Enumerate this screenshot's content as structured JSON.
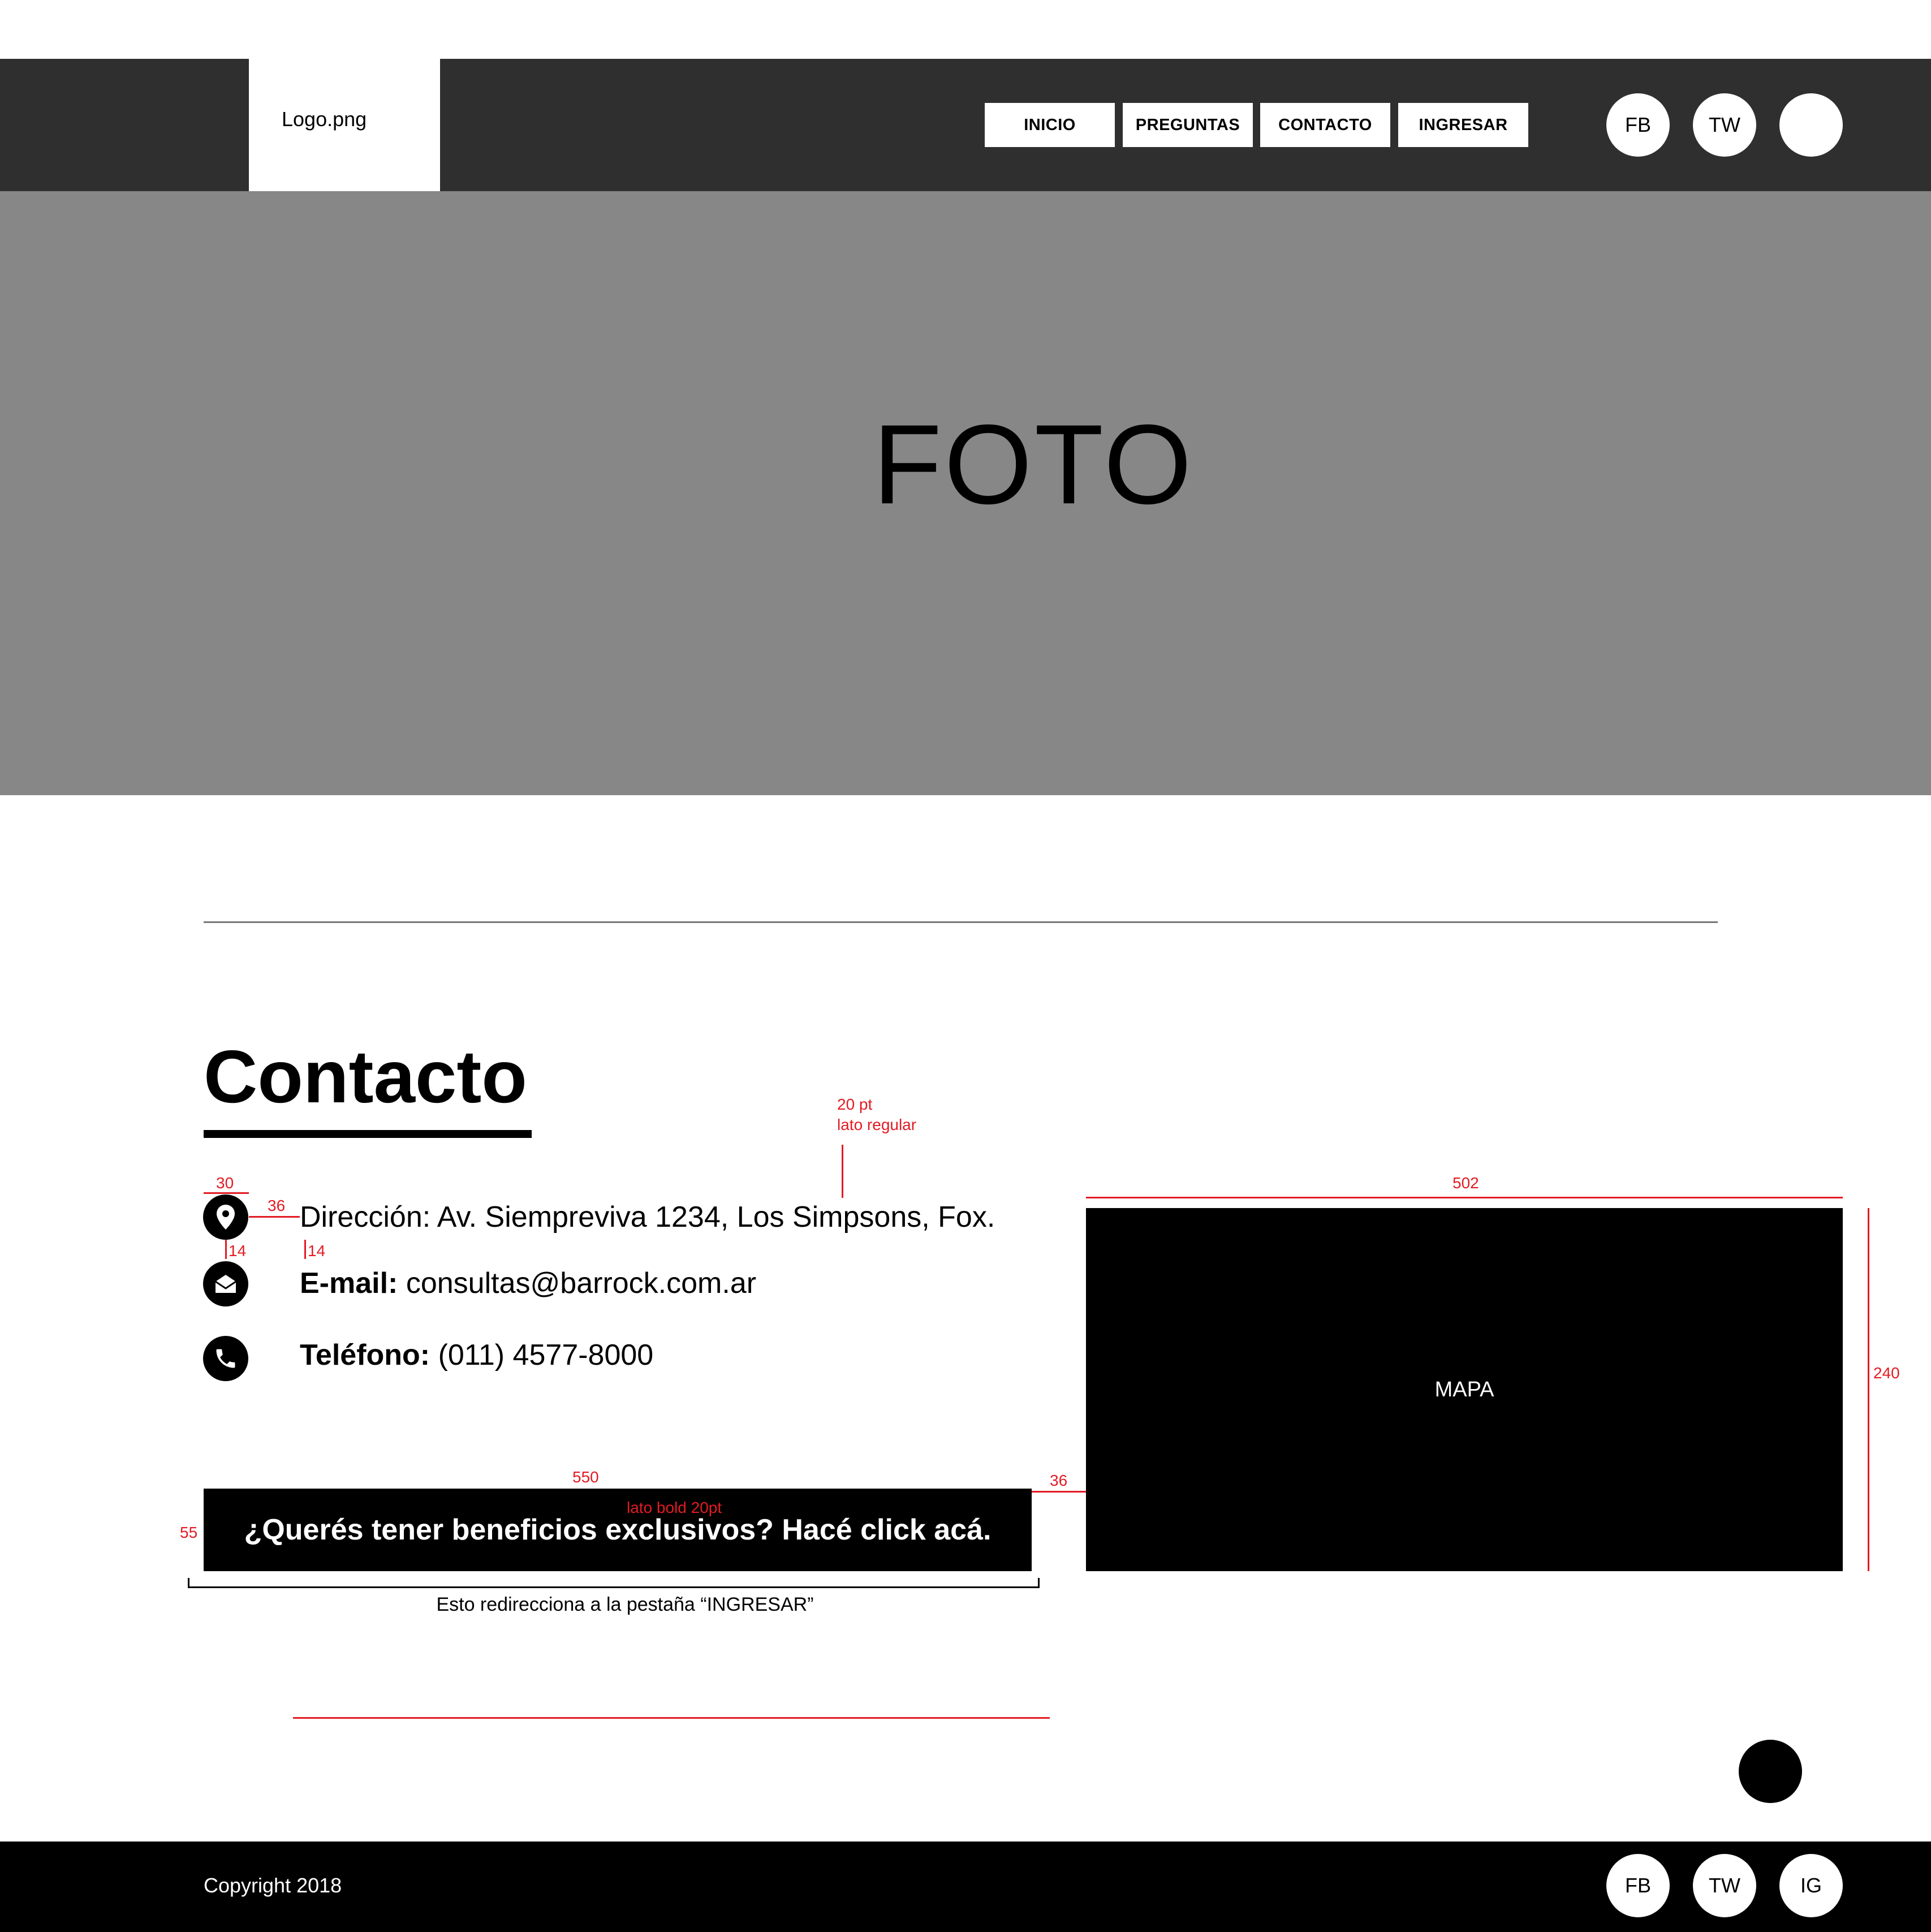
{
  "header": {
    "logo_text": "Logo.png",
    "nav": [
      "INICIO",
      "PREGUNTAS",
      "CONTACTO",
      "INGRESAR"
    ],
    "social": [
      "FB",
      "TW",
      ""
    ]
  },
  "hero": {
    "text": "FOTO"
  },
  "contact": {
    "title": "Contacto",
    "address": {
      "value": "Dirección: Av. Siempreviva 1234, Los Simpsons, Fox."
    },
    "email": {
      "label": "E-mail:",
      "value": " consultas@barrock.com.ar"
    },
    "phone": {
      "label": "Teléfono:",
      "value": " (011) 4577-8000"
    },
    "cta": "¿Querés tener beneficios exclusivos? Hacé click acá.",
    "note": "Esto redirecciona a la pestaña “INGRESAR”",
    "map_label": "MAPA"
  },
  "annotations": {
    "font_line1": "20 pt",
    "font_line2": "lato regular",
    "icon_size": "30",
    "icon_gap": "36",
    "row_gap_a": "14",
    "row_gap_b": "14",
    "map_width": "502",
    "map_height": "240",
    "cta_width": "550",
    "cta_font": "lato bold 20pt",
    "cta_height": "55",
    "cta_map_gap": "36"
  },
  "footer": {
    "copyright": "Copyright 2018",
    "social": [
      "FB",
      "TW",
      "IG"
    ]
  },
  "colors": {
    "header_bg": "#2f2f2f",
    "hero_bg": "#878787",
    "annotation": "#e31b23",
    "footer_bg": "#000000"
  },
  "icons": [
    "location-pin-icon",
    "envelope-icon",
    "phone-icon"
  ]
}
